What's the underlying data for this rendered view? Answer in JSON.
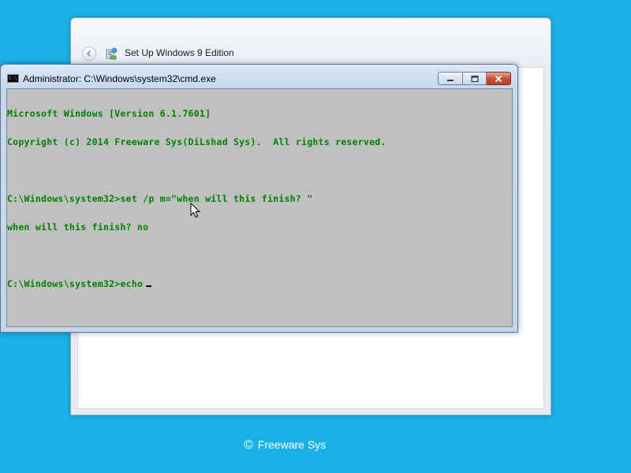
{
  "setup": {
    "title": "Set Up Windows 9 Edition"
  },
  "cmd": {
    "title": "Administrator: C:\\Windows\\system32\\cmd.exe",
    "icon_text": "C:\\",
    "lines": [
      "Microsoft Windows [Version 6.1.7601]",
      "Copyright (c) 2014 Freeware Sys(DiLshad Sys).  All rights reserved.",
      "",
      "C:\\Windows\\system32>set /p m=\"when will this finish? \"",
      "when will this finish? no",
      "",
      "C:\\Windows\\system32>echo"
    ],
    "text_color": "#008000",
    "background_color": "#c0c0c0"
  },
  "footer": {
    "copyright_symbol": "©",
    "brand": "Freeware Sys"
  },
  "colors": {
    "desktop": "#1ab2e6",
    "close_button": "#c74a33"
  },
  "icons": {
    "back": "back-arrow-icon",
    "setup": "setup-icon",
    "cmd": "command-prompt-icon",
    "minimize": "minimize-icon",
    "maximize": "maximize-icon",
    "close": "close-icon",
    "pointer": "mouse-pointer-icon"
  }
}
